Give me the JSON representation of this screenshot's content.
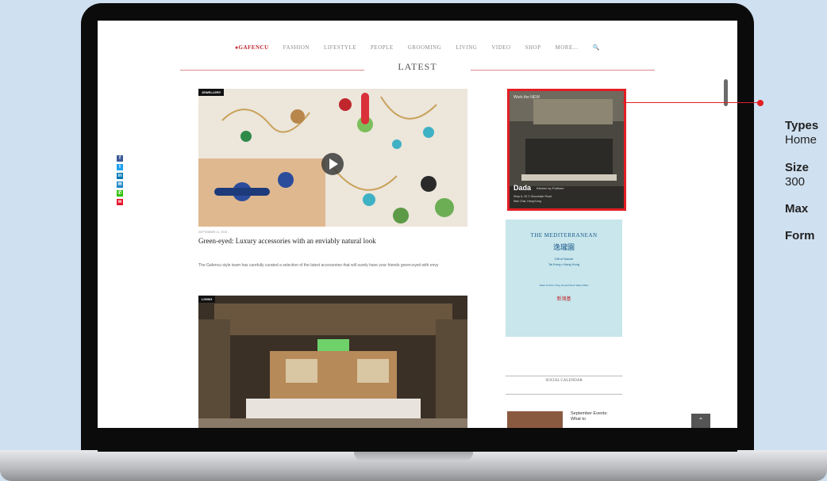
{
  "site_nav": {
    "brand": "GAFENCU",
    "items": [
      "FASHION",
      "LIFESTYLE",
      "PEOPLE",
      "GROOMING",
      "LIVING",
      "VIDEO",
      "SHOP",
      "MORE..."
    ]
  },
  "section_title": "LATEST",
  "share": [
    {
      "icon": "facebook-icon",
      "glyph": "f",
      "color": "#3b5998"
    },
    {
      "icon": "twitter-icon",
      "glyph": "t",
      "color": "#1da1f2"
    },
    {
      "icon": "linkedin-icon",
      "glyph": "in",
      "color": "#0077b5"
    },
    {
      "icon": "email-icon",
      "glyph": "✉",
      "color": "#1e88c9"
    },
    {
      "icon": "wechat-icon",
      "glyph": "✆",
      "color": "#2dc100"
    },
    {
      "icon": "weibo-icon",
      "glyph": "w",
      "color": "#e6162d"
    }
  ],
  "article1": {
    "tag": "JEWELLERY",
    "date": "SEPTEMBER 11, 2018",
    "title": "Green-eyed: Luxury accessories with an enviably natural look",
    "excerpt": "The Gafencu style team has carefully curated a selection of the latest accessories that will surely have your friends green-eyed with envy"
  },
  "article2": {
    "tag": "LIVING"
  },
  "ad1": {
    "headline": "Work the NEW",
    "brand": "Dada",
    "tagline": "Kitchen by Poliform",
    "line1": "Shop A, 33 C Gloucester Road",
    "line2": "Wan Chai, Hong Kong"
  },
  "ad2": {
    "title": "THE MEDITERRANEAN",
    "chinese": "逸瓏園",
    "sub1": "Gift of Nature",
    "sub2": "Tai Kong • Hong Kong",
    "body": "Sales of Kwun Tong Ground Floor Sales Office",
    "logo": "新鴻基"
  },
  "social_calendar": {
    "heading": "SOCIAL CALENDAR",
    "item_title": "September Events: What to"
  },
  "callout": {
    "type_label": "Types",
    "type_value": "Home",
    "size_label": "Size",
    "size_value": "300",
    "max_label": "Max",
    "format_label": "Form"
  },
  "colors": {
    "accent": "#e31e24",
    "brand": "#c0272d"
  }
}
